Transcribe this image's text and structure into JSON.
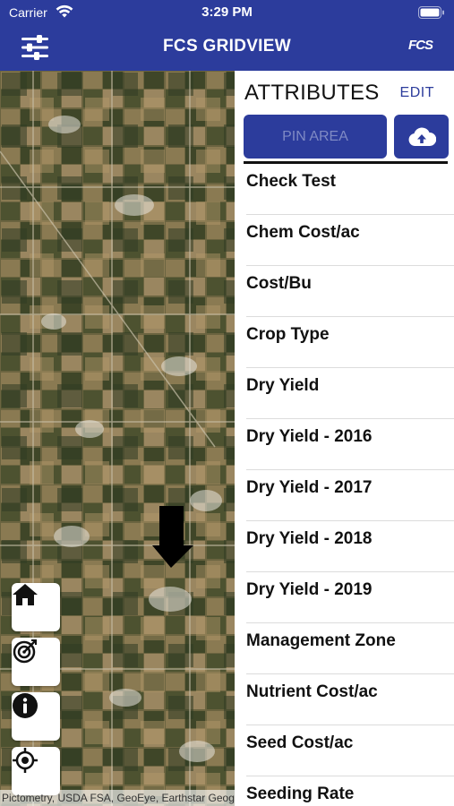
{
  "status_bar": {
    "carrier": "Carrier",
    "time": "3:29 PM"
  },
  "nav": {
    "title": "FCS GRIDVIEW",
    "logo_text": "FCS",
    "filter_icon": "sliders-icon"
  },
  "map": {
    "attribution": "Pictometry, USDA FSA, GeoEye, Earthstar Geographics",
    "buttons": [
      {
        "icon": "home-icon"
      },
      {
        "icon": "target-icon"
      },
      {
        "icon": "info-icon"
      },
      {
        "icon": "locate-icon"
      }
    ]
  },
  "attributes": {
    "title": "ATTRIBUTES",
    "edit_label": "EDIT",
    "pin_area_label": "PIN AREA",
    "upload_icon": "cloud-upload-icon",
    "items": [
      "Check Test",
      "Chem Cost/ac",
      "Cost/Bu",
      "Crop Type",
      "Dry Yield",
      "Dry Yield - 2016",
      "Dry Yield - 2017",
      "Dry Yield - 2018",
      "Dry Yield - 2019",
      "Management Zone",
      "Nutrient Cost/ac",
      "Seed Cost/ac",
      "Seeding Rate"
    ]
  },
  "colors": {
    "primary": "#2c3c9c",
    "pin_area_text": "#7f8ac4",
    "edit_text": "#2c3c9c"
  }
}
